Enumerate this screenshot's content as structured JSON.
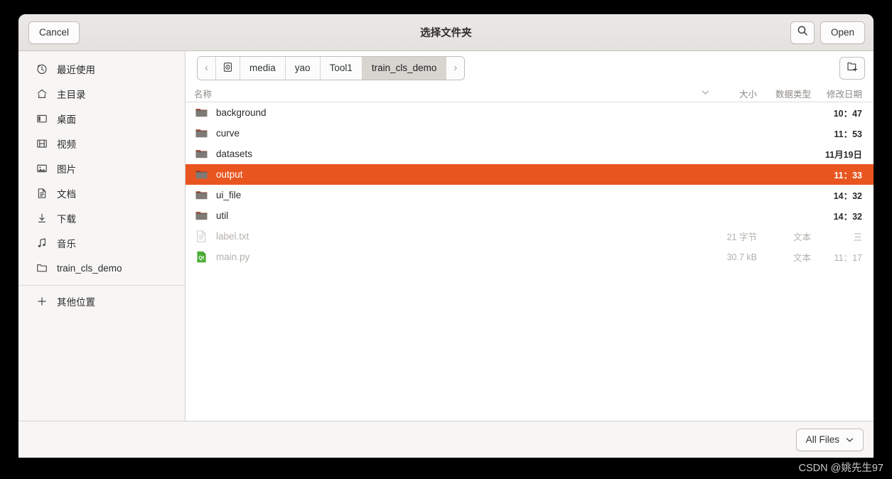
{
  "window": {
    "title": "选择文件夹",
    "cancel_label": "Cancel",
    "open_label": "Open",
    "search_icon": "search-icon",
    "newfolder_icon": "new-folder-icon"
  },
  "sidebar": {
    "items": [
      {
        "label": "最近使用",
        "icon": "clock-icon"
      },
      {
        "label": "主目录",
        "icon": "home-icon"
      },
      {
        "label": "桌面",
        "icon": "desktop-icon"
      },
      {
        "label": "视频",
        "icon": "video-icon"
      },
      {
        "label": "图片",
        "icon": "image-icon"
      },
      {
        "label": "文档",
        "icon": "document-icon"
      },
      {
        "label": "下载",
        "icon": "download-icon"
      },
      {
        "label": "音乐",
        "icon": "music-icon"
      },
      {
        "label": "train_cls_demo",
        "icon": "folder-icon"
      }
    ],
    "other_locations": {
      "label": "其他位置",
      "icon": "plus-icon"
    }
  },
  "pathbar": {
    "back_label": "‹",
    "forward_label": "›",
    "disk_icon": "disk-icon",
    "crumbs": [
      {
        "label": "media",
        "active": false
      },
      {
        "label": "yao",
        "active": false
      },
      {
        "label": "Tool1",
        "active": false
      },
      {
        "label": "train_cls_demo",
        "active": true
      }
    ]
  },
  "columns": {
    "name": "名称",
    "size": "大小",
    "type": "数据类型",
    "modified": "修改日期",
    "sort_icon": "chevron-down-icon"
  },
  "files": [
    {
      "name": "background",
      "size": "",
      "type": "",
      "modified": "10：47",
      "kind": "folder",
      "selected": false,
      "dim": false
    },
    {
      "name": "curve",
      "size": "",
      "type": "",
      "modified": "11：53",
      "kind": "folder",
      "selected": false,
      "dim": false
    },
    {
      "name": "datasets",
      "size": "",
      "type": "",
      "modified": "11月19日",
      "kind": "folder",
      "selected": false,
      "dim": false
    },
    {
      "name": "output",
      "size": "",
      "type": "",
      "modified": "11：33",
      "kind": "folder",
      "selected": true,
      "dim": false
    },
    {
      "name": "ui_file",
      "size": "",
      "type": "",
      "modified": "14：32",
      "kind": "folder",
      "selected": false,
      "dim": false
    },
    {
      "name": "util",
      "size": "",
      "type": "",
      "modified": "14：32",
      "kind": "folder",
      "selected": false,
      "dim": false
    },
    {
      "name": "label.txt",
      "size": "21 字节",
      "type": "文本",
      "modified": "三",
      "kind": "text",
      "selected": false,
      "dim": true
    },
    {
      "name": "main.py",
      "size": "30.7 kB",
      "type": "文本",
      "modified": "11：17",
      "kind": "qt",
      "selected": false,
      "dim": true
    }
  ],
  "footer": {
    "filter_label": "All Files",
    "filter_icon": "chevron-down-icon"
  },
  "watermark": "CSDN @姚先生97",
  "colors": {
    "selection": "#e9551f",
    "headerbar": "#e8e5e2",
    "sidebar": "#f7f6f5",
    "folder_body": "#7e7a76",
    "folder_top": "#9c3b26",
    "qt_green": "#4caf37"
  }
}
